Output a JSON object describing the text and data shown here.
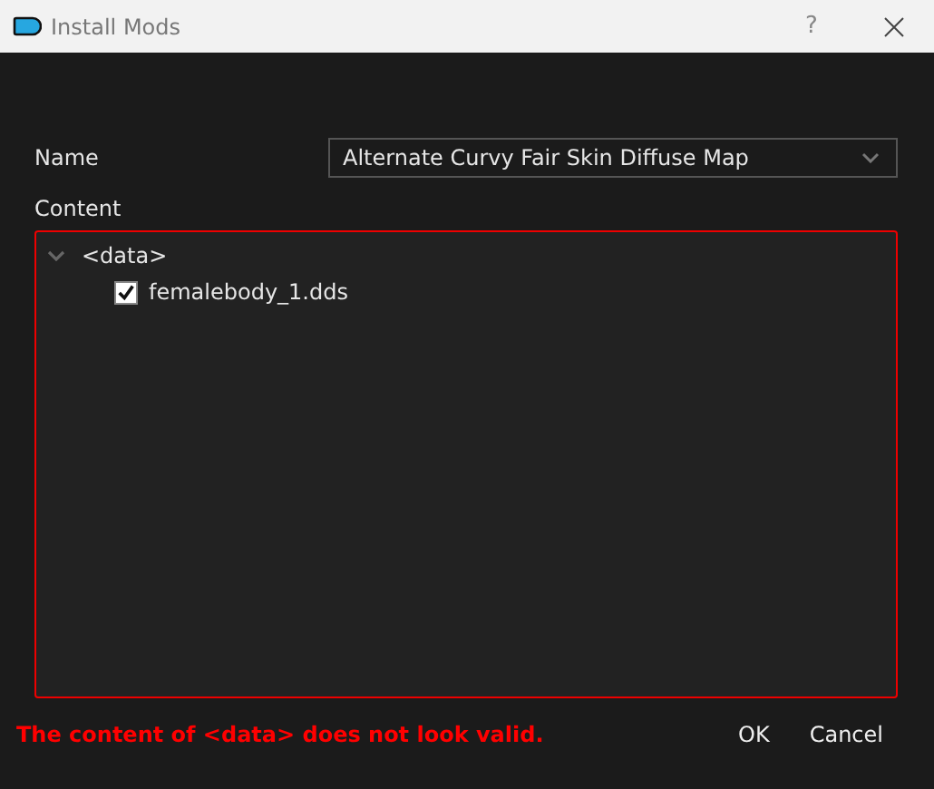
{
  "window": {
    "title": "Install Mods",
    "help": "?"
  },
  "name_field": {
    "label": "Name",
    "value": "Alternate Curvy Fair Skin Diffuse Map"
  },
  "content": {
    "label": "Content",
    "invalid": true,
    "tree": [
      {
        "label": "<data>",
        "expanded": true,
        "children": [
          {
            "label": "femalebody_1.dds",
            "checked": true
          }
        ]
      }
    ]
  },
  "error": "The content of <data> does not look valid.",
  "buttons": [
    "OK",
    "Cancel"
  ]
}
